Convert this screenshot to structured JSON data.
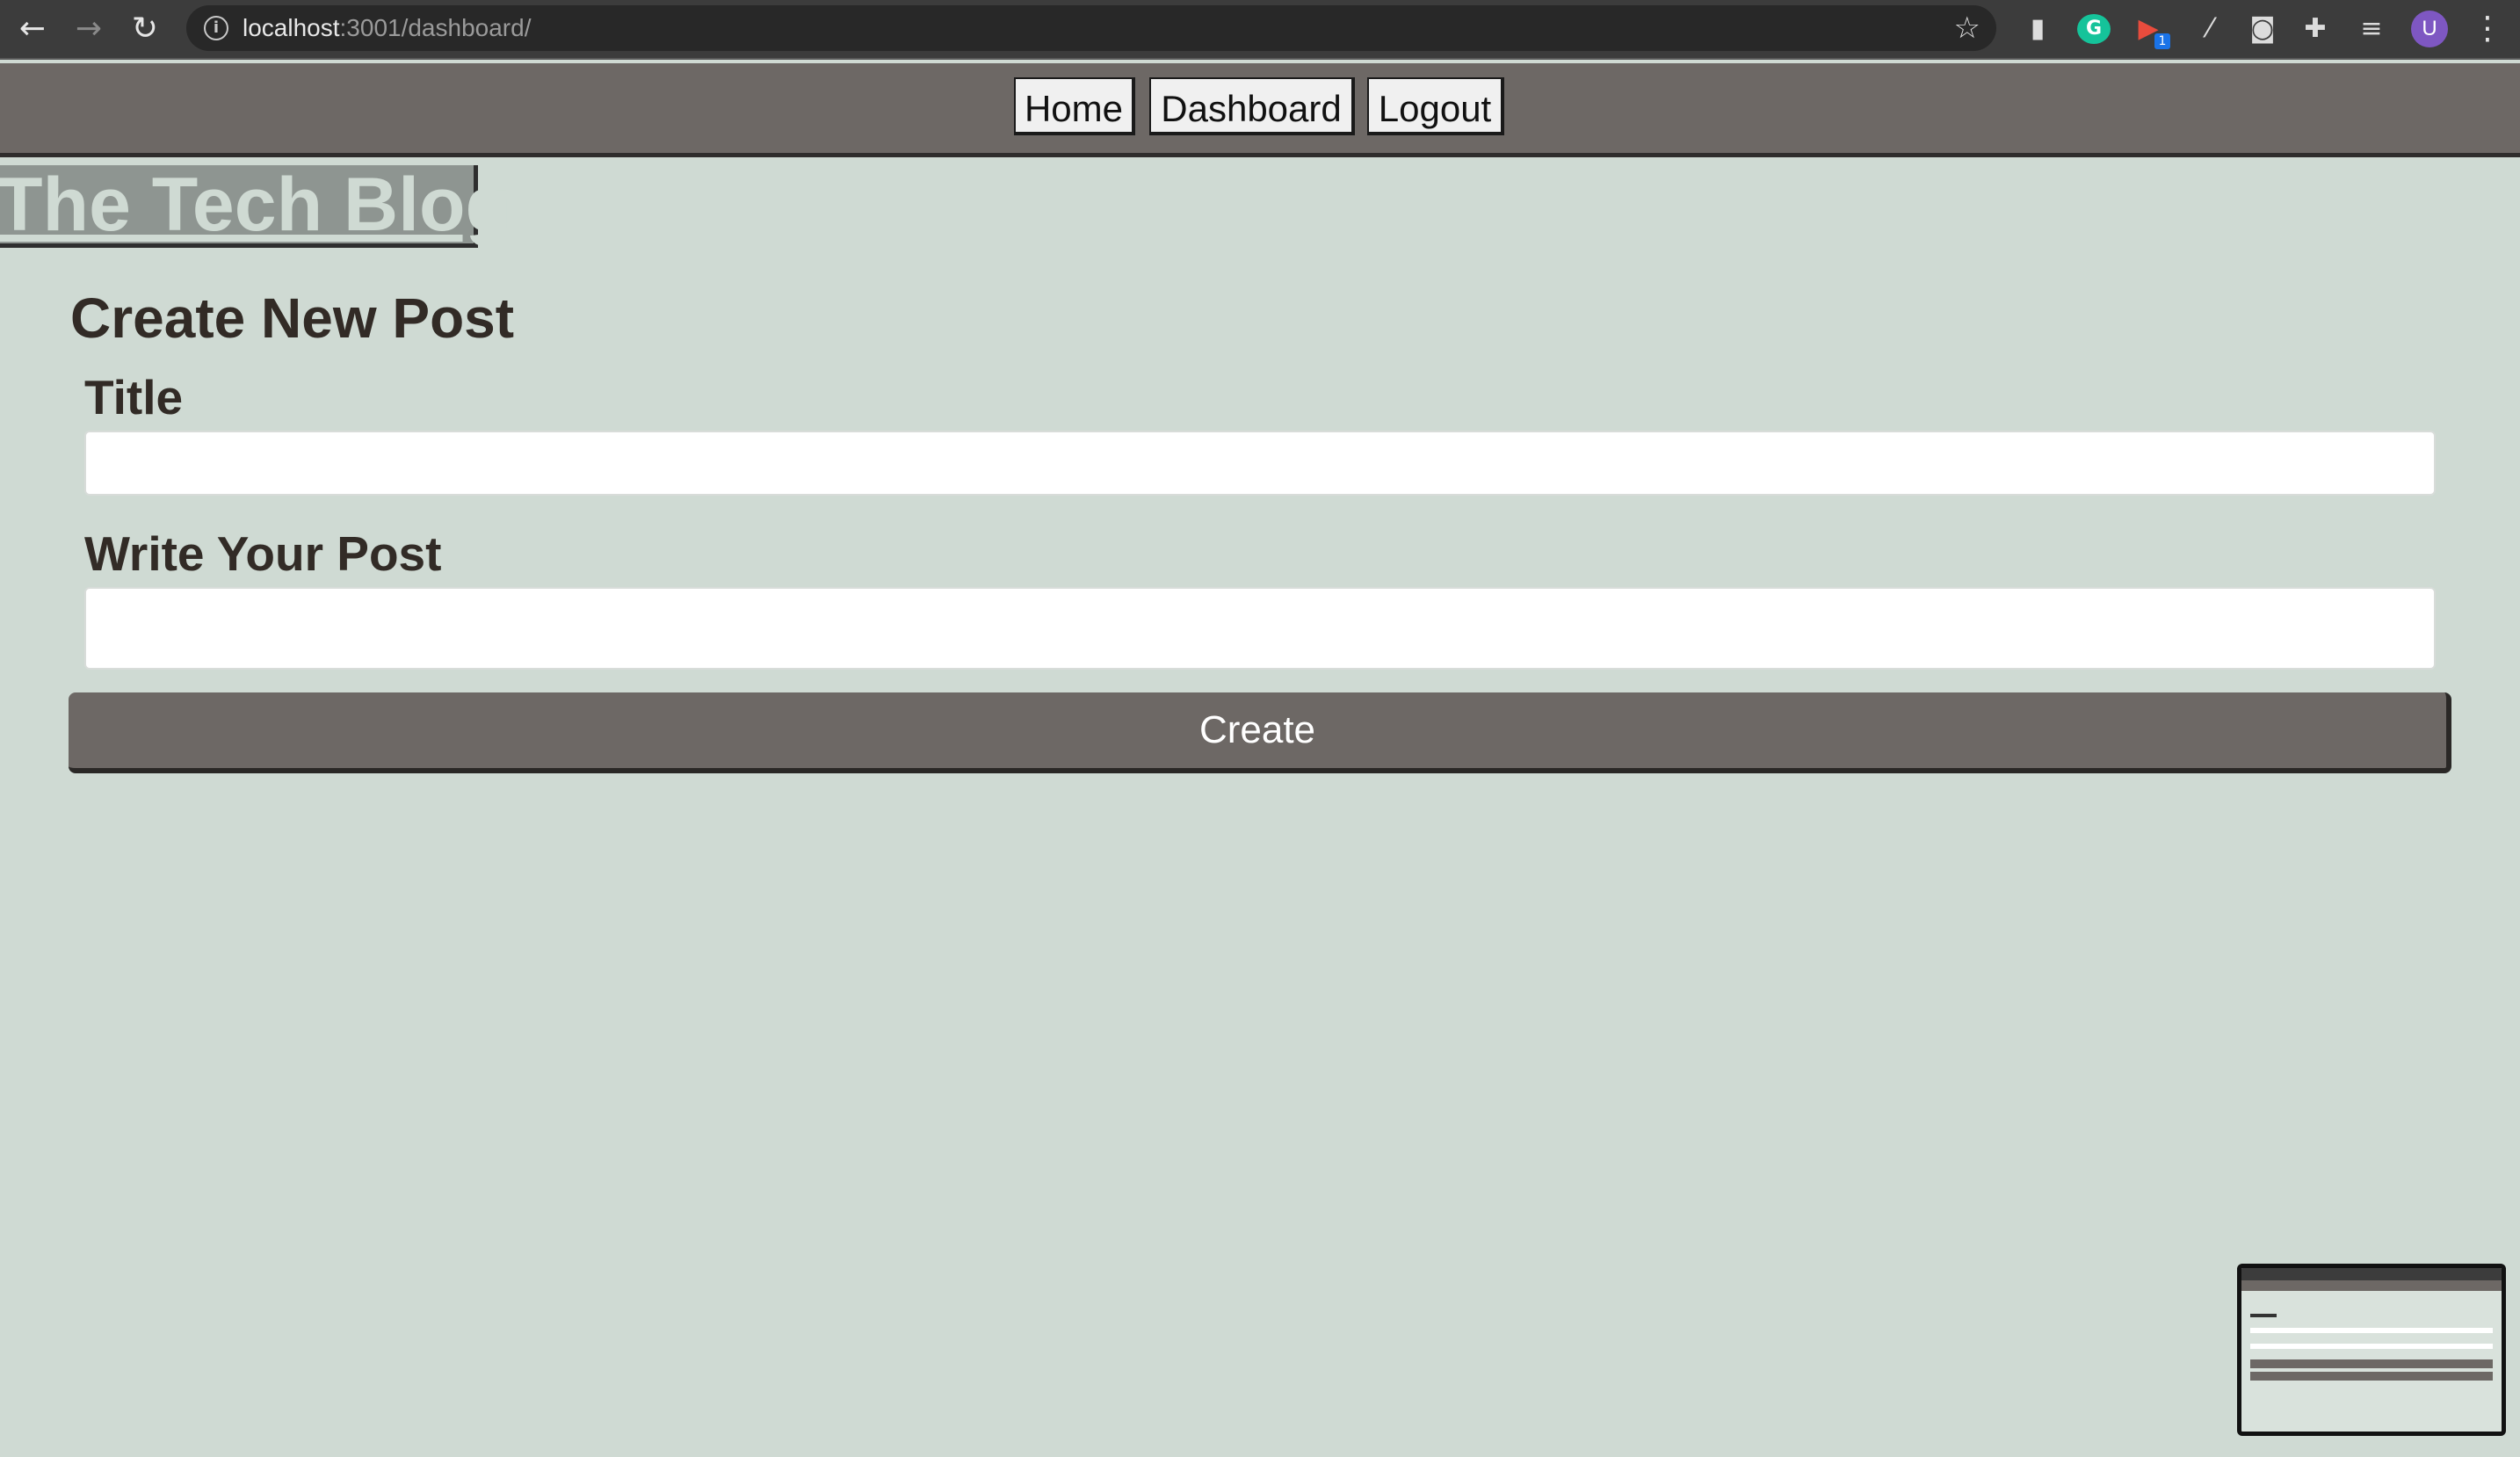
{
  "browser": {
    "url_host": "localhost",
    "url_path": ":3001/dashboard/",
    "avatar_letter": "U",
    "extension_badge": "1",
    "extension_g_letter": "G"
  },
  "nav": {
    "home": "Home",
    "dashboard": "Dashboard",
    "logout": "Logout"
  },
  "brand": {
    "title": "The Tech Blog"
  },
  "form": {
    "heading": "Create New Post",
    "title_label": "Title",
    "title_value": "",
    "body_label": "Write Your Post",
    "body_value": "",
    "submit_label": "Create"
  },
  "colors": {
    "page_bg": "#cfdad3",
    "nav_bg": "#6d6865",
    "brand_bg": "#8e9591",
    "text": "#322b26"
  }
}
